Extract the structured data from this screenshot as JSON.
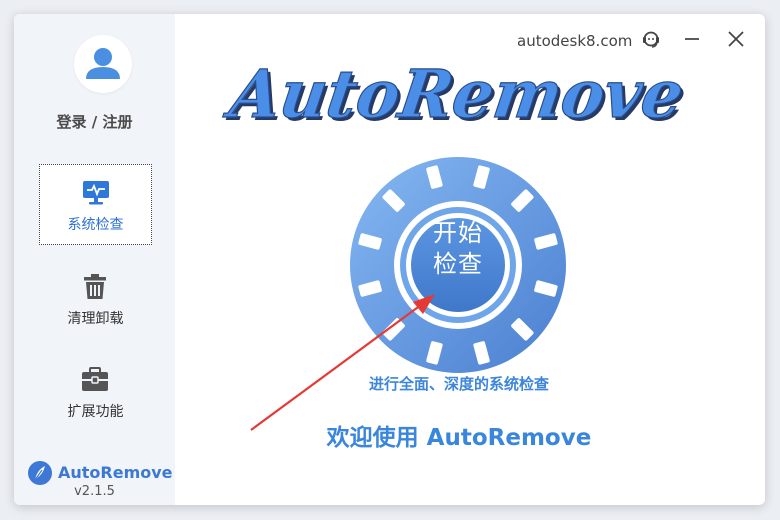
{
  "app": {
    "name": "AutoRemove",
    "version": "v2.1.5"
  },
  "header": {
    "site": "autodesk8.com",
    "support_icon": "headset-icon",
    "minimize_icon": "minimize-icon",
    "close_icon": "close-icon"
  },
  "sidebar": {
    "login_label": "登录 / 注册",
    "items": [
      {
        "label": "系统检查",
        "icon": "monitor-icon",
        "active": true
      },
      {
        "label": "清理卸载",
        "icon": "trash-icon",
        "active": false
      },
      {
        "label": "扩展功能",
        "icon": "toolbox-icon",
        "active": false
      }
    ]
  },
  "main": {
    "title": "AutoRemove",
    "start_line1": "开始",
    "start_line2": "检查",
    "subtitle": "进行全面、深度的系统检查",
    "welcome": "欢迎使用 AutoRemove"
  },
  "colors": {
    "accent": "#3d86dc",
    "disc_light": "#7fb2f0",
    "disc_dark": "#4f86d6",
    "arrow": "#e53935",
    "sidebar_bg": "#f1f4f8"
  }
}
